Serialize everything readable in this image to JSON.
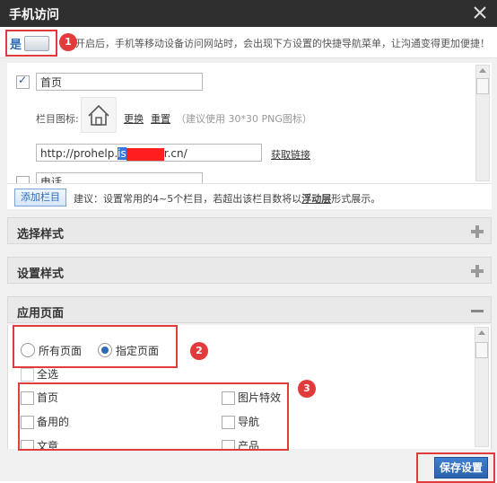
{
  "window": {
    "title": "手机访问",
    "close_icon": "close-icon"
  },
  "topbar": {
    "toggle_label": "是",
    "description": "开启后，手机等移动设备访问网站时，会出现下方设置的快捷导航菜单，让沟通变得更加便捷！"
  },
  "markers": [
    "1",
    "2",
    "3"
  ],
  "nav_item": {
    "name_value": "首页",
    "icon_label": "栏目图标:",
    "change_link": "更换",
    "reset_link": "重置",
    "icon_hint": "（建议使用 30*30 PNG图标）",
    "url_prefix": "http://prohelp.",
    "url_selected": "is",
    "url_suffix": "r.cn/",
    "get_link": "获取链接",
    "next_name_value": "电话"
  },
  "add_row": {
    "add_button": "添加栏目",
    "tip_before": "建议：设置常用的4~5个栏目，若超出该栏目数将以",
    "tip_link": "浮动层",
    "tip_after": "形式展示。"
  },
  "sections": {
    "style_select": "选择样式",
    "style_settings": "设置样式",
    "app_pages": "应用页面"
  },
  "app_pages": {
    "radio_all": "所有页面",
    "radio_specific": "指定页面",
    "select_all": "全选",
    "left_pages": [
      "首页",
      "备用的",
      "文章"
    ],
    "right_pages": [
      "图片特效",
      "导航",
      "产品"
    ]
  },
  "bottom": {
    "save_button": "保存设置"
  },
  "colors": {
    "accent": "#2b6bb6",
    "marker_red": "#e23b3b",
    "titlebar": "#2f2f2f"
  }
}
